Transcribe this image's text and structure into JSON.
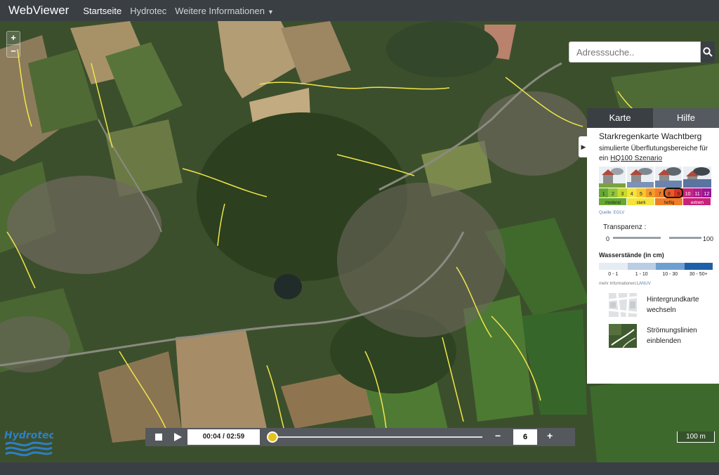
{
  "navbar": {
    "brand": "WebViewer",
    "links": [
      "Startseite",
      "Hydrotec",
      "Weitere Informationen"
    ]
  },
  "map": {
    "zoom_in": "+",
    "zoom_out": "−"
  },
  "search": {
    "placeholder": "Adresssuche.."
  },
  "panel": {
    "tabs": [
      "Karte",
      "Hilfe"
    ],
    "title": "Starkregenkarte Wachtberg",
    "subtitle_prefix": "simulierte Überflutungsbereiche für ein ",
    "subtitle_link": "HQ100 Szenario",
    "scale_numbers": [
      "1",
      "2",
      "3",
      "4",
      "5",
      "6",
      "7",
      "8",
      "9",
      "10",
      "11",
      "12"
    ],
    "scale_groups": [
      "moderat",
      "stark",
      "heftig",
      "extrem"
    ],
    "scale_colors": [
      "#66a832",
      "#8fc43b",
      "#c8d92c",
      "#f4e33b",
      "#f5c72b",
      "#f39a2a",
      "#ef7d25",
      "#e85a22",
      "#d6341f",
      "#c9227a",
      "#b21b8f",
      "#9a1495"
    ],
    "source": "Quelle: EGLV",
    "transparency_label": "Transparenz :",
    "transparency_min": "0",
    "transparency_max": "100",
    "waterlevel_title": "Wasserstände (in cm)",
    "waterlevel_labels": [
      "0 - 1",
      "1 - 10",
      "10 - 30",
      "30 - 50+"
    ],
    "waterlevel_colors": [
      "#e6ecf3",
      "#b9cde4",
      "#6f9fd1",
      "#1f5fa8"
    ],
    "more_info_prefix": "mehr Informationen:",
    "more_info_link": "LANUV",
    "option_background": [
      "Hintergrundkarte",
      "wechseln"
    ],
    "option_flowlines": [
      "Strömungslinien",
      "einblenden"
    ]
  },
  "player": {
    "time": "00:04 / 02:59",
    "speed": "6",
    "minus": "−",
    "plus": "+",
    "progress": 0.02
  },
  "scalebar": "100 m",
  "logo": "Hydrotec"
}
